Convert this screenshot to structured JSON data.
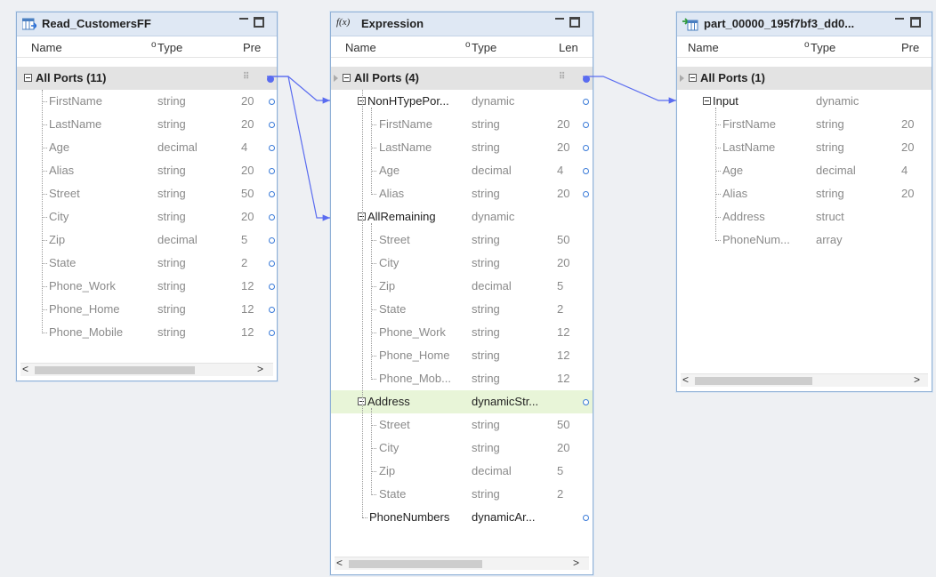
{
  "panels": {
    "source": {
      "title": "Read_CustomersFF",
      "col_name": "Name",
      "col_type": "Type",
      "col_extra": "Pre",
      "all_ports": "All Ports (11)",
      "rows": [
        {
          "name": "FirstName",
          "type": "string",
          "prec": "20"
        },
        {
          "name": "LastName",
          "type": "string",
          "prec": "20"
        },
        {
          "name": "Age",
          "type": "decimal",
          "prec": "4"
        },
        {
          "name": "Alias",
          "type": "string",
          "prec": "20"
        },
        {
          "name": "Street",
          "type": "string",
          "prec": "50"
        },
        {
          "name": "City",
          "type": "string",
          "prec": "20"
        },
        {
          "name": "Zip",
          "type": "decimal",
          "prec": "5"
        },
        {
          "name": "State",
          "type": "string",
          "prec": "2"
        },
        {
          "name": "Phone_Work",
          "type": "string",
          "prec": "12"
        },
        {
          "name": "Phone_Home",
          "type": "string",
          "prec": "12"
        },
        {
          "name": "Phone_Mobile",
          "type": "string",
          "prec": "12"
        }
      ]
    },
    "expression": {
      "title": "Expression",
      "icon_label": "f(x)",
      "col_name": "Name",
      "col_type": "Type",
      "col_extra": "Len",
      "all_ports": "All Ports (4)",
      "groups": [
        {
          "name": "NonHTypePor...",
          "type": "dynamic",
          "children": [
            {
              "name": "FirstName",
              "type": "string",
              "prec": "20"
            },
            {
              "name": "LastName",
              "type": "string",
              "prec": "20"
            },
            {
              "name": "Age",
              "type": "decimal",
              "prec": "4"
            },
            {
              "name": "Alias",
              "type": "string",
              "prec": "20"
            }
          ]
        },
        {
          "name": "AllRemaining",
          "type": "dynamic",
          "children": [
            {
              "name": "Street",
              "type": "string",
              "prec": "50"
            },
            {
              "name": "City",
              "type": "string",
              "prec": "20"
            },
            {
              "name": "Zip",
              "type": "decimal",
              "prec": "5"
            },
            {
              "name": "State",
              "type": "string",
              "prec": "2"
            },
            {
              "name": "Phone_Work",
              "type": "string",
              "prec": "12"
            },
            {
              "name": "Phone_Home",
              "type": "string",
              "prec": "12"
            },
            {
              "name": "Phone_Mob...",
              "type": "string",
              "prec": "12"
            }
          ]
        },
        {
          "name": "Address",
          "type": "dynamicStr...",
          "children": [
            {
              "name": "Street",
              "type": "string",
              "prec": "50"
            },
            {
              "name": "City",
              "type": "string",
              "prec": "20"
            },
            {
              "name": "Zip",
              "type": "decimal",
              "prec": "5"
            },
            {
              "name": "State",
              "type": "string",
              "prec": "2"
            }
          ]
        },
        {
          "name": "PhoneNumbers",
          "type": "dynamicAr...",
          "children": []
        }
      ]
    },
    "target": {
      "title": "part_00000_195f7bf3_dd0...",
      "col_name": "Name",
      "col_type": "Type",
      "col_extra": "Pre",
      "all_ports": "All Ports (1)",
      "group": {
        "name": "Input",
        "type": "dynamic"
      },
      "rows": [
        {
          "name": "FirstName",
          "type": "string",
          "prec": "20"
        },
        {
          "name": "LastName",
          "type": "string",
          "prec": "20"
        },
        {
          "name": "Age",
          "type": "decimal",
          "prec": "4"
        },
        {
          "name": "Alias",
          "type": "string",
          "prec": "20"
        },
        {
          "name": "Address",
          "type": "struct",
          "prec": ""
        },
        {
          "name": "PhoneNum...",
          "type": "array",
          "prec": ""
        }
      ]
    }
  },
  "colors": {
    "link": "#5a6cf0",
    "highlight": "#e8f5d8",
    "title_bg": "#dfe8f4"
  }
}
